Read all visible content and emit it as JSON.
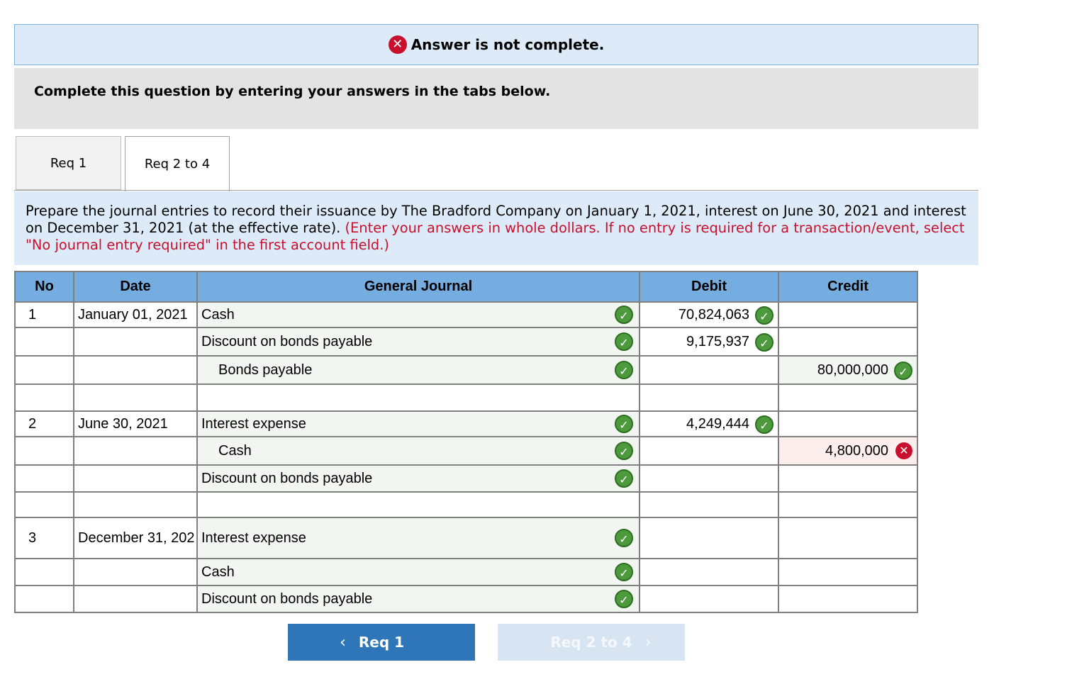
{
  "banner": {
    "text": "Answer is not complete."
  },
  "instructions": {
    "text": "Complete this question by entering your answers in the tabs below."
  },
  "tabs": [
    {
      "label": "Req 1"
    },
    {
      "label": "Req 2 to 4"
    }
  ],
  "prompt": {
    "main": "Prepare the journal entries to record their issuance by The Bradford Company on January 1, 2021, interest on June 30, 2021 and interest on December 31, 2021 (at the effective rate).",
    "note": "(Enter your answers in whole dollars. If no entry is required for a transaction/event, select \"No journal entry required\" in the first account field.)"
  },
  "table": {
    "headers": {
      "no": "No",
      "date": "Date",
      "journal": "General Journal",
      "debit": "Debit",
      "credit": "Credit"
    },
    "rows": [
      {
        "no": "1",
        "date": "January 01, 2021",
        "account": "Cash",
        "debit": "70,824,063",
        "credit": ""
      },
      {
        "no": "",
        "date": "",
        "account": "Discount on bonds payable",
        "debit": "9,175,937",
        "credit": ""
      },
      {
        "no": "",
        "date": "",
        "account": "Bonds payable",
        "debit": "",
        "credit": "80,000,000"
      },
      {
        "no": "",
        "date": "",
        "account": "",
        "debit": "",
        "credit": ""
      },
      {
        "no": "2",
        "date": "June 30, 2021",
        "account": "Interest expense",
        "debit": "4,249,444",
        "credit": ""
      },
      {
        "no": "",
        "date": "",
        "account": "Cash",
        "debit": "",
        "credit": "4,800,000"
      },
      {
        "no": "",
        "date": "",
        "account": "Discount on bonds payable",
        "debit": "",
        "credit": ""
      },
      {
        "no": "",
        "date": "",
        "account": "",
        "debit": "",
        "credit": ""
      },
      {
        "no": "3",
        "date": "December 31, 202",
        "account": "Interest expense",
        "debit": "",
        "credit": ""
      },
      {
        "no": "",
        "date": "",
        "account": "Cash",
        "debit": "",
        "credit": ""
      },
      {
        "no": "",
        "date": "",
        "account": "Discount on bonds payable",
        "debit": "",
        "credit": ""
      }
    ]
  },
  "nav": {
    "prev_label": "Req 1",
    "next_label": "Req 2 to 4"
  },
  "icons": {
    "error": "x-circle-icon",
    "correct": "check-circle-icon",
    "prev": "chevron-left-icon",
    "next": "chevron-right-icon"
  },
  "colors": {
    "error": "#c8102e",
    "correct": "#4d9a3c",
    "header": "#76ade0",
    "primary": "#2f76b9"
  }
}
